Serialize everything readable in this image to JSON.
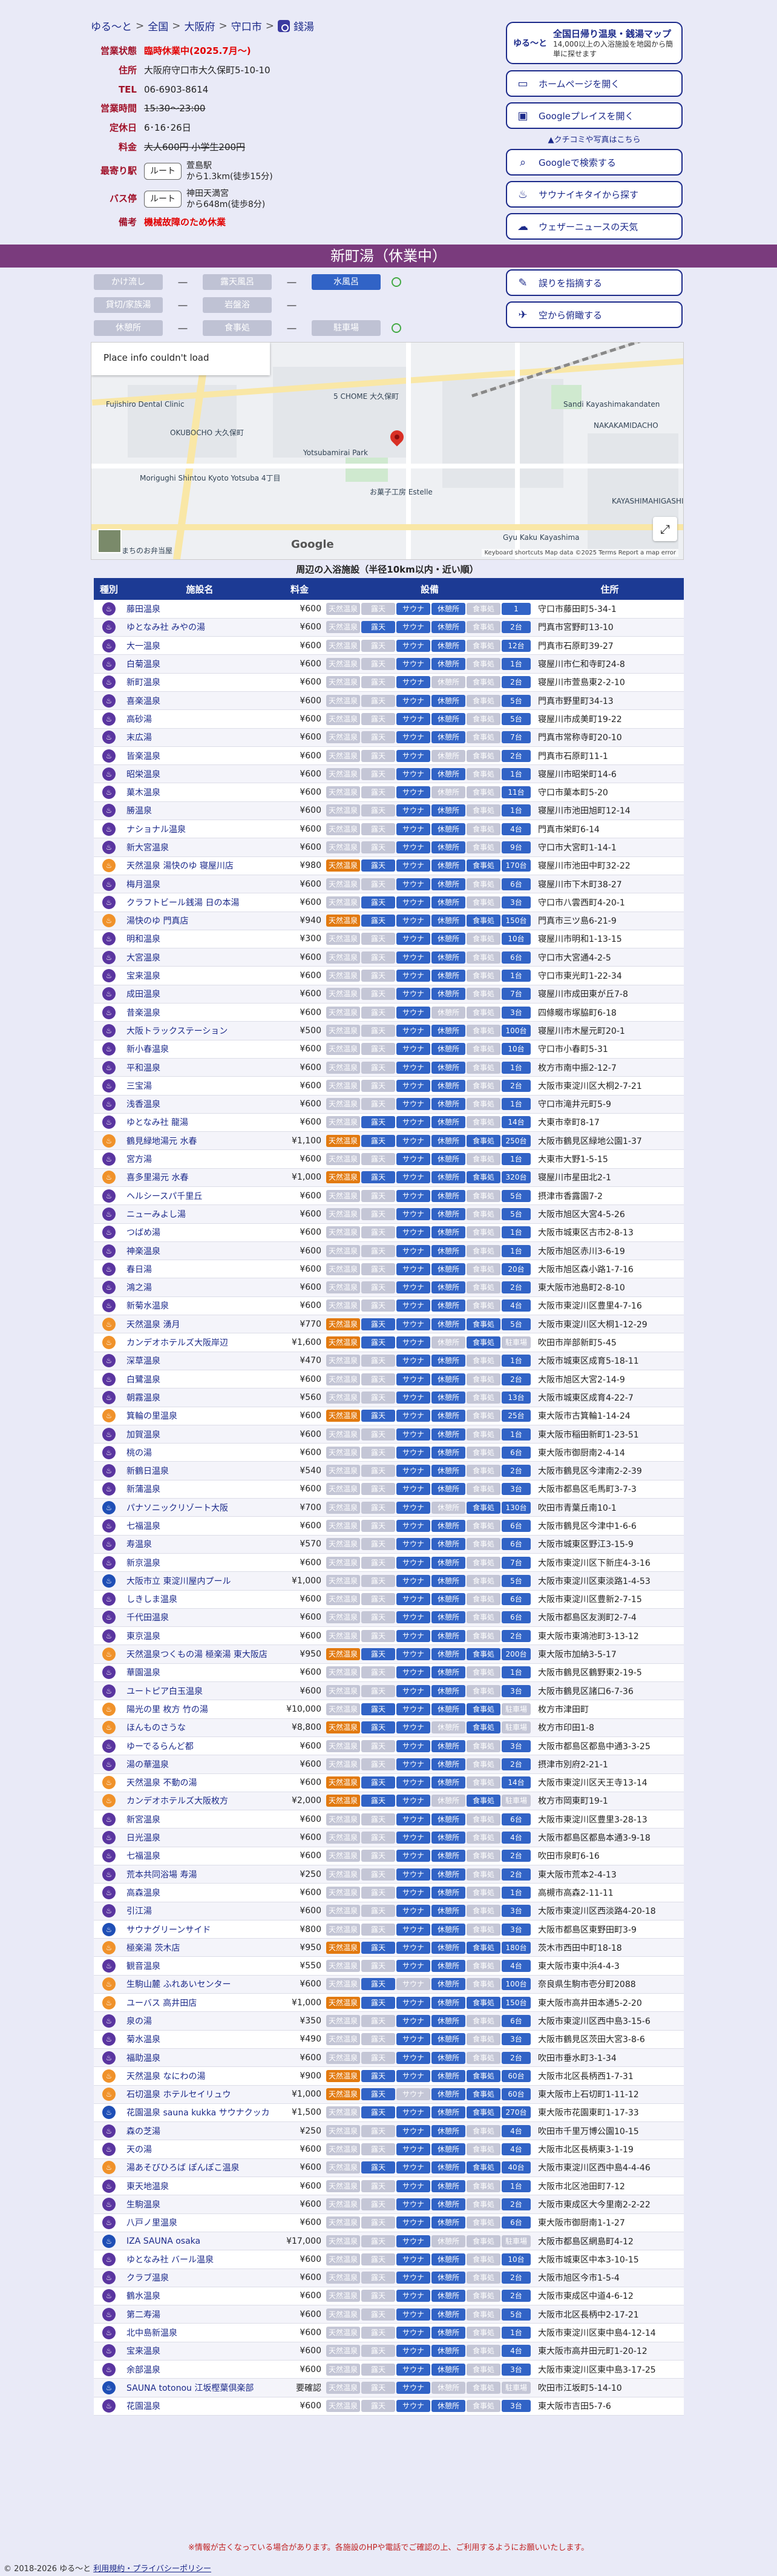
{
  "breadcrumb": [
    "ゆる〜と",
    "全国",
    "大阪府",
    "守口市",
    "錢湯"
  ],
  "info": {
    "status_label": "営業状態",
    "status_value": "臨時休業中(2025.7月〜)",
    "addr_label": "住所",
    "addr_value": "大阪府守口市大久保町5-10-10",
    "tel_label": "TEL",
    "tel_value": "06-6903-8614",
    "hours_label": "営業時間",
    "hours_value": "15:30〜23:00",
    "holiday_label": "定休日",
    "holiday_value": "6･16･26日",
    "fee_label": "料金",
    "fee_adult": "大人600円",
    "fee_child": "小学生200円",
    "station_label": "最寄り駅",
    "station_btn": "ルート",
    "station_name": "萱島駅",
    "station_dist": "から1.3km(徒歩15分)",
    "bus_label": "バス停",
    "bus_btn": "ルート",
    "bus_name": "神田天満宮",
    "bus_dist": "から648m(徒歩8分)",
    "note_label": "備考",
    "note_value": "機械故障のため休業"
  },
  "side": {
    "banner_logo": "ゆる〜と",
    "banner_title": "全国日帰り温泉・銭湯マップ",
    "banner_sub": "14,000以上の入浴施設を地図から簡単に探せます",
    "buttons": [
      "ホームページを開く",
      "Googleプレイスを開く",
      "Googleで検索する",
      "サウナイキタイから探す",
      "ウェザーニュースの天気",
      "誤りを指摘する",
      "空から俯瞰する"
    ],
    "note_pre": "▲",
    "note_link": "クチコミや写真はこちら"
  },
  "status_bar": "新町湯（休業中）",
  "hidden_fac": {
    "r1": [
      "かけ流し",
      "―",
      "露天風呂",
      "―",
      "水風呂"
    ],
    "r2": [
      "貸切/家族湯",
      "―",
      "岩盤浴",
      "―"
    ],
    "r3": [
      "休憩所",
      "―",
      "食事処",
      "―",
      "駐車場"
    ]
  },
  "map": {
    "error": "Place info couldn't load",
    "labels": [
      "Fujishiro Dental Clinic",
      "OKUBOCHO 大久保町",
      "Yotsubamirai Park",
      "Morigughi Shintou Kyoto Yotsuba 4丁目",
      "NAKAKAMIDACHO",
      "Sandi Kayashimakandaten",
      "KAYASHIMAHIGASHI",
      "Gyu Kaku Kayashima",
      "5 CHOME 大久保町",
      "お菓子工房 Estelle",
      "まちのお弁当屋"
    ],
    "logo": "Google",
    "attr": "Keyboard shortcuts  Map data ©2025  Terms  Report a map error"
  },
  "nearby_title": "周辺の入浴施設（半径10km以内・近い順）",
  "nearby_headers": [
    "種別",
    "施設名",
    "料金",
    "設備",
    "住所"
  ],
  "fac_names": [
    "天然温泉",
    "露天",
    "サウナ",
    "休憩所",
    "食事処",
    "駐車場"
  ],
  "nearby": [
    [
      "s",
      "藤田温泉",
      "¥600",
      [
        0,
        0,
        1,
        1,
        0,
        "1"
      ],
      "守口市藤田町5-34-1"
    ],
    [
      "s",
      "ゆとなみ社 みやの湯",
      "¥600",
      [
        0,
        1,
        1,
        1,
        0,
        "2台"
      ],
      "門真市宮野町13-10"
    ],
    [
      "s",
      "大一温泉",
      "¥600",
      [
        0,
        0,
        1,
        1,
        0,
        "12台"
      ],
      "門真市石原町39-27"
    ],
    [
      "s",
      "白菊温泉",
      "¥600",
      [
        0,
        0,
        1,
        1,
        0,
        "1台"
      ],
      "寝屋川市仁和寺町24-8"
    ],
    [
      "s",
      "新町温泉",
      "¥600",
      [
        0,
        0,
        1,
        0,
        0,
        "2台"
      ],
      "寝屋川市萱島東2-2-10"
    ],
    [
      "s",
      "喜楽温泉",
      "¥600",
      [
        0,
        0,
        1,
        1,
        0,
        "5台"
      ],
      "門真市野里町34-13"
    ],
    [
      "s",
      "高砂湯",
      "¥600",
      [
        0,
        0,
        1,
        1,
        0,
        "5台"
      ],
      "寝屋川市成美町19-22"
    ],
    [
      "s",
      "末広湯",
      "¥600",
      [
        0,
        0,
        1,
        1,
        0,
        "7台"
      ],
      "門真市常称寺町20-10"
    ],
    [
      "s",
      "皆楽温泉",
      "¥600",
      [
        0,
        0,
        1,
        0,
        0,
        "2台"
      ],
      "門真市石原町11-1"
    ],
    [
      "s",
      "昭栄温泉",
      "¥600",
      [
        0,
        0,
        1,
        1,
        0,
        "1台"
      ],
      "寝屋川市昭栄町14-6"
    ],
    [
      "s",
      "菓木温泉",
      "¥600",
      [
        0,
        0,
        1,
        0,
        0,
        "11台"
      ],
      "守口市菓本町5-20"
    ],
    [
      "s",
      "勝温泉",
      "¥600",
      [
        0,
        0,
        1,
        1,
        0,
        "1台"
      ],
      "寝屋川市池田旭町12-14"
    ],
    [
      "s",
      "ナショナル温泉",
      "¥600",
      [
        0,
        0,
        1,
        1,
        0,
        "4台"
      ],
      "門真市栄町6-14"
    ],
    [
      "s",
      "新大宮温泉",
      "¥600",
      [
        0,
        0,
        1,
        1,
        0,
        "9台"
      ],
      "守口市大宮町1-14-1"
    ],
    [
      "x",
      "天然温泉 湯快のゆ 寝屋川店",
      "¥980",
      [
        1,
        1,
        1,
        1,
        1,
        "170台"
      ],
      "寝屋川市池田中町32-22"
    ],
    [
      "s",
      "梅月温泉",
      "¥600",
      [
        0,
        0,
        1,
        1,
        0,
        "6台"
      ],
      "寝屋川市下木町38-27"
    ],
    [
      "s",
      "クラフトビール銭湯 日の本湯",
      "¥600",
      [
        0,
        1,
        1,
        1,
        0,
        "3台"
      ],
      "守口市八雲西町4-20-1"
    ],
    [
      "x",
      "湯快のゆ 門真店",
      "¥940",
      [
        1,
        1,
        1,
        1,
        1,
        "150台"
      ],
      "門真市三ツ島6-21-9"
    ],
    [
      "s",
      "明和温泉",
      "¥300",
      [
        0,
        0,
        1,
        1,
        0,
        "10台"
      ],
      "寝屋川市明和1-13-15"
    ],
    [
      "s",
      "大宮温泉",
      "¥600",
      [
        0,
        0,
        1,
        1,
        0,
        "6台"
      ],
      "守口市大宮通4-2-5"
    ],
    [
      "s",
      "宝来温泉",
      "¥600",
      [
        0,
        0,
        1,
        1,
        0,
        "1台"
      ],
      "守口市東光町1-22-34"
    ],
    [
      "s",
      "成田温泉",
      "¥600",
      [
        0,
        0,
        1,
        1,
        0,
        "7台"
      ],
      "寝屋川市成田東が丘7-8"
    ],
    [
      "s",
      "昔楽温泉",
      "¥600",
      [
        0,
        0,
        1,
        0,
        0,
        "3台"
      ],
      "四條畷市塚脇町6-18"
    ],
    [
      "s",
      "大阪トラックステーション",
      "¥500",
      [
        0,
        0,
        1,
        1,
        0,
        "100台"
      ],
      "寝屋川市木屋元町20-1"
    ],
    [
      "s",
      "新小春温泉",
      "¥600",
      [
        0,
        0,
        1,
        1,
        0,
        "10台"
      ],
      "守口市小春町5-31"
    ],
    [
      "s",
      "平和温泉",
      "¥600",
      [
        0,
        0,
        1,
        1,
        0,
        "1台"
      ],
      "枚方市南中振2-12-7"
    ],
    [
      "s",
      "三宝湯",
      "¥600",
      [
        0,
        0,
        1,
        1,
        0,
        "2台"
      ],
      "大阪市東淀川区大桐2-7-21"
    ],
    [
      "s",
      "浅香温泉",
      "¥600",
      [
        0,
        0,
        1,
        1,
        0,
        "1台"
      ],
      "守口市滝井元町5-9"
    ],
    [
      "s",
      "ゆとなみ社 龍湯",
      "¥600",
      [
        0,
        1,
        1,
        1,
        0,
        "14台"
      ],
      "大東市幸町8-17"
    ],
    [
      "x",
      "鶴見緑地湯元 水春",
      "¥1,100",
      [
        1,
        1,
        1,
        1,
        1,
        "250台"
      ],
      "大阪市鶴見区緑地公園1-37"
    ],
    [
      "s",
      "宮方湯",
      "¥600",
      [
        0,
        0,
        1,
        1,
        0,
        "1台"
      ],
      "大東市大野1-5-15"
    ],
    [
      "x",
      "喜多里湯元 水春",
      "¥1,000",
      [
        1,
        1,
        1,
        1,
        1,
        "320台"
      ],
      "寝屋川市星田北2-1"
    ],
    [
      "s",
      "ヘルシースパ千里丘",
      "¥600",
      [
        0,
        0,
        1,
        1,
        0,
        "5台"
      ],
      "摂津市香露園7-2"
    ],
    [
      "s",
      "ニューみよし湯",
      "¥600",
      [
        0,
        0,
        1,
        1,
        0,
        "5台"
      ],
      "大阪市旭区大宮4-5-26"
    ],
    [
      "s",
      "つばめ湯",
      "¥600",
      [
        0,
        0,
        1,
        1,
        0,
        "1台"
      ],
      "大阪市城東区古市2-8-13"
    ],
    [
      "s",
      "神楽温泉",
      "¥600",
      [
        0,
        0,
        1,
        1,
        0,
        "1台"
      ],
      "大阪市旭区赤川3-6-19"
    ],
    [
      "s",
      "春日湯",
      "¥600",
      [
        0,
        0,
        1,
        1,
        0,
        "20台"
      ],
      "大阪市旭区森小路1-7-16"
    ],
    [
      "s",
      "鴻之湯",
      "¥600",
      [
        0,
        0,
        1,
        1,
        0,
        "2台"
      ],
      "東大阪市池島町2-8-10"
    ],
    [
      "s",
      "新菊水温泉",
      "¥600",
      [
        0,
        0,
        1,
        1,
        0,
        "4台"
      ],
      "大阪市東淀川区豊里4-7-16"
    ],
    [
      "x",
      "天然温泉 湧月",
      "¥770",
      [
        1,
        1,
        1,
        1,
        1,
        "5台"
      ],
      "大阪市東淀川区大桐1-12-29"
    ],
    [
      "x",
      "カンデオホテルズ大阪岸辺",
      "¥1,600",
      [
        1,
        1,
        1,
        0,
        1,
        ""
      ],
      "吹田市岸部新町5-45"
    ],
    [
      "s",
      "深草温泉",
      "¥470",
      [
        0,
        0,
        1,
        1,
        0,
        "1台"
      ],
      "大阪市城東区成育5-18-11"
    ],
    [
      "s",
      "白鷺温泉",
      "¥600",
      [
        0,
        0,
        1,
        1,
        0,
        "2台"
      ],
      "大阪市旭区大宮2-14-9"
    ],
    [
      "s",
      "朝霧温泉",
      "¥560",
      [
        0,
        0,
        1,
        1,
        0,
        "13台"
      ],
      "大阪市城東区成育4-22-7"
    ],
    [
      "x",
      "箕輪の里温泉",
      "¥600",
      [
        1,
        1,
        1,
        1,
        0,
        "25台"
      ],
      "東大阪市古箕輪1-14-24"
    ],
    [
      "s",
      "加賀温泉",
      "¥600",
      [
        0,
        0,
        1,
        1,
        0,
        "1台"
      ],
      "東大阪市稲田新町1-23-51"
    ],
    [
      "s",
      "桃の湯",
      "¥600",
      [
        0,
        0,
        1,
        1,
        0,
        "6台"
      ],
      "東大阪市御厨南2-4-14"
    ],
    [
      "s",
      "新鶴日温泉",
      "¥540",
      [
        0,
        0,
        1,
        1,
        0,
        "2台"
      ],
      "大阪市鶴見区今津南2-2-39"
    ],
    [
      "s",
      "新蒲温泉",
      "¥600",
      [
        0,
        0,
        1,
        1,
        0,
        "3台"
      ],
      "大阪市都島区毛馬町3-7-3"
    ],
    [
      "a",
      "パナソニックリゾート大阪",
      "¥700",
      [
        0,
        0,
        1,
        0,
        1,
        "130台"
      ],
      "吹田市青葉丘南10-1"
    ],
    [
      "s",
      "七福温泉",
      "¥600",
      [
        0,
        0,
        1,
        1,
        0,
        "6台"
      ],
      "大阪市鶴見区今津中1-6-6"
    ],
    [
      "s",
      "寿温泉",
      "¥570",
      [
        0,
        0,
        1,
        1,
        0,
        "6台"
      ],
      "大阪市城東区野江3-15-9"
    ],
    [
      "s",
      "新京温泉",
      "¥600",
      [
        0,
        0,
        1,
        1,
        0,
        "7台"
      ],
      "大阪市東淀川区下新庄4-3-16"
    ],
    [
      "a",
      "大阪市立 東淀川屋内プール",
      "¥1,000",
      [
        0,
        0,
        1,
        1,
        0,
        "5台"
      ],
      "大阪市東淀川区東淡路1-4-53"
    ],
    [
      "s",
      "しきしま温泉",
      "¥600",
      [
        0,
        0,
        1,
        1,
        0,
        "6台"
      ],
      "大阪市東淀川区豊新2-7-15"
    ],
    [
      "s",
      "千代田温泉",
      "¥600",
      [
        0,
        0,
        1,
        1,
        0,
        "6台"
      ],
      "大阪市都島区友渕町2-7-4"
    ],
    [
      "s",
      "東京温泉",
      "¥600",
      [
        0,
        0,
        1,
        1,
        0,
        "2台"
      ],
      "東大阪市東鴻池町3-13-12"
    ],
    [
      "x",
      "天然温泉つくもの湯 極楽湯 東大阪店",
      "¥950",
      [
        1,
        1,
        1,
        1,
        1,
        "200台"
      ],
      "東大阪市加納3-5-17"
    ],
    [
      "s",
      "華園温泉",
      "¥600",
      [
        0,
        0,
        1,
        1,
        0,
        "1台"
      ],
      "大阪市鶴見区鶴野東2-19-5"
    ],
    [
      "s",
      "ユートピア白玉温泉",
      "¥600",
      [
        0,
        0,
        1,
        1,
        0,
        "3台"
      ],
      "大阪市鶴見区諸口6-7-36"
    ],
    [
      "x",
      "陽光の里 枚方 竹の湯",
      "¥10,000",
      [
        0,
        1,
        1,
        1,
        1,
        ""
      ],
      "枚方市津田町"
    ],
    [
      "x",
      "ほんものさうな",
      "¥8,800",
      [
        1,
        1,
        1,
        0,
        1,
        ""
      ],
      "枚方市印田1-8"
    ],
    [
      "s",
      "ゆーでるらんど都",
      "¥600",
      [
        0,
        0,
        1,
        1,
        0,
        "3台"
      ],
      "大阪市都島区都島中通3-3-25"
    ],
    [
      "s",
      "湯の華温泉",
      "¥600",
      [
        0,
        0,
        1,
        1,
        0,
        "2台"
      ],
      "摂津市別府2-21-1"
    ],
    [
      "x",
      "天然温泉 不動の湯",
      "¥600",
      [
        1,
        1,
        1,
        1,
        0,
        "14台"
      ],
      "大阪市東淀川区天王寺13-14"
    ],
    [
      "x",
      "カンデオホテルズ大阪枚方",
      "¥2,000",
      [
        1,
        1,
        1,
        0,
        1,
        ""
      ],
      "枚方市岡東町19-1"
    ],
    [
      "s",
      "新宮温泉",
      "¥600",
      [
        0,
        0,
        1,
        1,
        0,
        "6台"
      ],
      "大阪市東淀川区豊里3-28-13"
    ],
    [
      "s",
      "日光温泉",
      "¥600",
      [
        0,
        0,
        1,
        1,
        0,
        "4台"
      ],
      "大阪市都島区都島本通3-9-18"
    ],
    [
      "s",
      "七福温泉",
      "¥600",
      [
        0,
        0,
        1,
        1,
        0,
        "2台"
      ],
      "吹田市泉町6-16"
    ],
    [
      "s",
      "荒本共同浴場 寿湯",
      "¥250",
      [
        0,
        0,
        1,
        1,
        0,
        "2台"
      ],
      "東大阪市荒本2-4-13"
    ],
    [
      "s",
      "高森温泉",
      "¥600",
      [
        0,
        0,
        1,
        1,
        0,
        "1台"
      ],
      "高槻市高森2-11-11"
    ],
    [
      "s",
      "引江湯",
      "¥600",
      [
        0,
        0,
        1,
        1,
        0,
        "3台"
      ],
      "大阪市東淀川区西淡路4-20-18"
    ],
    [
      "a",
      "サウナグリーンサイド",
      "¥800",
      [
        0,
        0,
        1,
        1,
        0,
        "3台"
      ],
      "大阪市都島区東野田町3-9"
    ],
    [
      "x",
      "極楽湯 茨木店",
      "¥950",
      [
        1,
        1,
        1,
        1,
        1,
        "180台"
      ],
      "茨木市西田中町18-18"
    ],
    [
      "s",
      "観音温泉",
      "¥550",
      [
        0,
        0,
        1,
        1,
        0,
        "4台"
      ],
      "東大阪市東中浜4-4-3"
    ],
    [
      "x",
      "生駒山麓 ふれあいセンター",
      "¥600",
      [
        0,
        1,
        0,
        1,
        0,
        "100台"
      ],
      "奈良県生駒市壱分町2088"
    ],
    [
      "x",
      "ユーバス 高井田店",
      "¥1,000",
      [
        1,
        1,
        1,
        1,
        1,
        "150台"
      ],
      "東大阪市高井田本通5-2-20"
    ],
    [
      "s",
      "泉の湯",
      "¥350",
      [
        0,
        0,
        1,
        1,
        0,
        "6台"
      ],
      "大阪市東淀川区西中島3-15-6"
    ],
    [
      "s",
      "菊水温泉",
      "¥490",
      [
        0,
        0,
        1,
        1,
        0,
        "3台"
      ],
      "大阪市鶴見区茨田大宮3-8-6"
    ],
    [
      "s",
      "福助温泉",
      "¥600",
      [
        0,
        0,
        1,
        1,
        0,
        "2台"
      ],
      "吹田市垂水町3-1-34"
    ],
    [
      "x",
      "天然温泉 なにわの湯",
      "¥900",
      [
        1,
        1,
        1,
        1,
        1,
        "60台"
      ],
      "大阪市北区長柄西1-7-31"
    ],
    [
      "x",
      "石切温泉 ホテルセイリュウ",
      "¥1,000",
      [
        1,
        1,
        0,
        1,
        1,
        "60台"
      ],
      "東大阪市上石切町1-11-12"
    ],
    [
      "a",
      "花園温泉 sauna kukka サウナクッカ",
      "¥1,500",
      [
        0,
        1,
        1,
        1,
        1,
        "270台"
      ],
      "東大阪市花園東町1-17-33"
    ],
    [
      "s",
      "森の芝湯",
      "¥250",
      [
        0,
        0,
        1,
        1,
        0,
        "4台"
      ],
      "吹田市千里万博公園10-15"
    ],
    [
      "s",
      "天の湯",
      "¥600",
      [
        0,
        0,
        1,
        1,
        0,
        "4台"
      ],
      "大阪市北区長柄東3-1-19"
    ],
    [
      "x",
      "湯あそびひろば ぽんぽこ温泉",
      "¥600",
      [
        0,
        1,
        1,
        1,
        1,
        "40台"
      ],
      "大阪市東淀川区西中島4-4-46"
    ],
    [
      "s",
      "東天地温泉",
      "¥600",
      [
        0,
        0,
        1,
        1,
        0,
        "1台"
      ],
      "大阪市北区池田町7-12"
    ],
    [
      "s",
      "生駒温泉",
      "¥600",
      [
        0,
        0,
        1,
        1,
        0,
        "2台"
      ],
      "大阪市東成区大今里南2-2-22"
    ],
    [
      "s",
      "八戸ノ里温泉",
      "¥600",
      [
        0,
        0,
        1,
        1,
        0,
        "6台"
      ],
      "東大阪市御厨南1-1-27"
    ],
    [
      "a",
      "IZA SAUNA osaka",
      "¥17,000",
      [
        0,
        0,
        1,
        0,
        0,
        ""
      ],
      "大阪市都島区網島町4-12"
    ],
    [
      "s",
      "ゆとなみ社 バール温泉",
      "¥600",
      [
        0,
        0,
        1,
        1,
        0,
        "10台"
      ],
      "大阪市城東区中本3-10-15"
    ],
    [
      "s",
      "クラブ温泉",
      "¥600",
      [
        0,
        0,
        1,
        1,
        0,
        "2台"
      ],
      "大阪市旭区今市1-5-4"
    ],
    [
      "s",
      "鶴水温泉",
      "¥600",
      [
        0,
        0,
        1,
        1,
        0,
        "2台"
      ],
      "大阪市東成区中道4-6-12"
    ],
    [
      "s",
      "第二寿湯",
      "¥600",
      [
        0,
        0,
        1,
        1,
        0,
        "5台"
      ],
      "大阪市北区長柄中2-17-21"
    ],
    [
      "s",
      "北中島新温泉",
      "¥600",
      [
        0,
        0,
        1,
        1,
        0,
        "1台"
      ],
      "大阪市東淀川区東中島4-12-14"
    ],
    [
      "s",
      "宝来温泉",
      "¥600",
      [
        0,
        0,
        1,
        1,
        0,
        "4台"
      ],
      "東大阪市高井田元町1-20-12"
    ],
    [
      "s",
      "余部温泉",
      "¥600",
      [
        0,
        0,
        1,
        1,
        0,
        "3台"
      ],
      "大阪市東淀川区東中島3-17-25"
    ],
    [
      "a",
      "SAUNA totonou 江坂樫葉倶楽部",
      "要確認",
      [
        0,
        0,
        1,
        0,
        0,
        ""
      ],
      "吹田市江坂町5-14-10"
    ],
    [
      "s",
      "花園温泉",
      "¥600",
      [
        0,
        0,
        1,
        1,
        0,
        "3台"
      ],
      "東大阪市吉田5-7-6"
    ]
  ],
  "footer_note": "※情報が古くなっている場合があります。各施設のHPや電話でご確認の上、ご利用するようにお願いいたします。",
  "copyright": "© 2018-2026 ゆる〜と",
  "copyright_link": "利用規約・プライバシーポリシー"
}
